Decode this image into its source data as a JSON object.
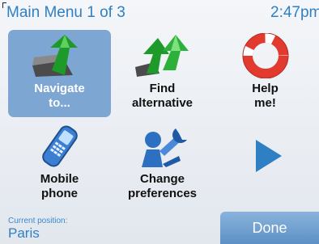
{
  "header": {
    "title": "Main Menu 1  of 3",
    "time": "2:47pm"
  },
  "menu": {
    "items": [
      {
        "line1": "Navigate",
        "line2": "to...",
        "icon": "navigate-arrow-icon",
        "selected": true
      },
      {
        "line1": "Find",
        "line2": "alternative",
        "icon": "find-alternative-icon"
      },
      {
        "line1": "Help",
        "line2": "me!",
        "icon": "lifebuoy-icon"
      },
      {
        "line1": "Mobile",
        "line2": "phone",
        "icon": "mobile-phone-icon"
      },
      {
        "line1": "Change",
        "line2": "preferences",
        "icon": "wrench-person-icon"
      },
      {
        "icon": "next-page-arrow-icon"
      }
    ]
  },
  "footer": {
    "position_label": "Current position:",
    "position_value": "Paris",
    "done_label": "Done"
  },
  "colors": {
    "accent": "#2f7fc4",
    "selected_tile": "#7ea6d3",
    "done_button": "#6f9fd1"
  }
}
